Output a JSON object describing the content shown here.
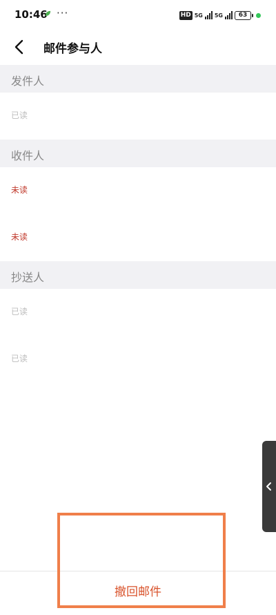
{
  "status_bar": {
    "time": "10:46",
    "more": "···",
    "hd": "HD",
    "net1": "5G",
    "net2": "5G",
    "battery": "63"
  },
  "nav": {
    "title": "邮件参与人"
  },
  "sections": {
    "sender": {
      "header": "发件人",
      "rows": [
        "已读"
      ]
    },
    "recipient": {
      "header": "收件人",
      "rows": [
        "未读",
        "未读"
      ]
    },
    "cc": {
      "header": "抄送人",
      "rows": [
        "已读",
        "已读"
      ]
    }
  },
  "footer": {
    "recall_label": "撤回邮件"
  },
  "colors": {
    "accent": "#d9532c",
    "unread": "#c0392b",
    "read": "#bdbdbd",
    "highlight": "#f07f4a"
  }
}
